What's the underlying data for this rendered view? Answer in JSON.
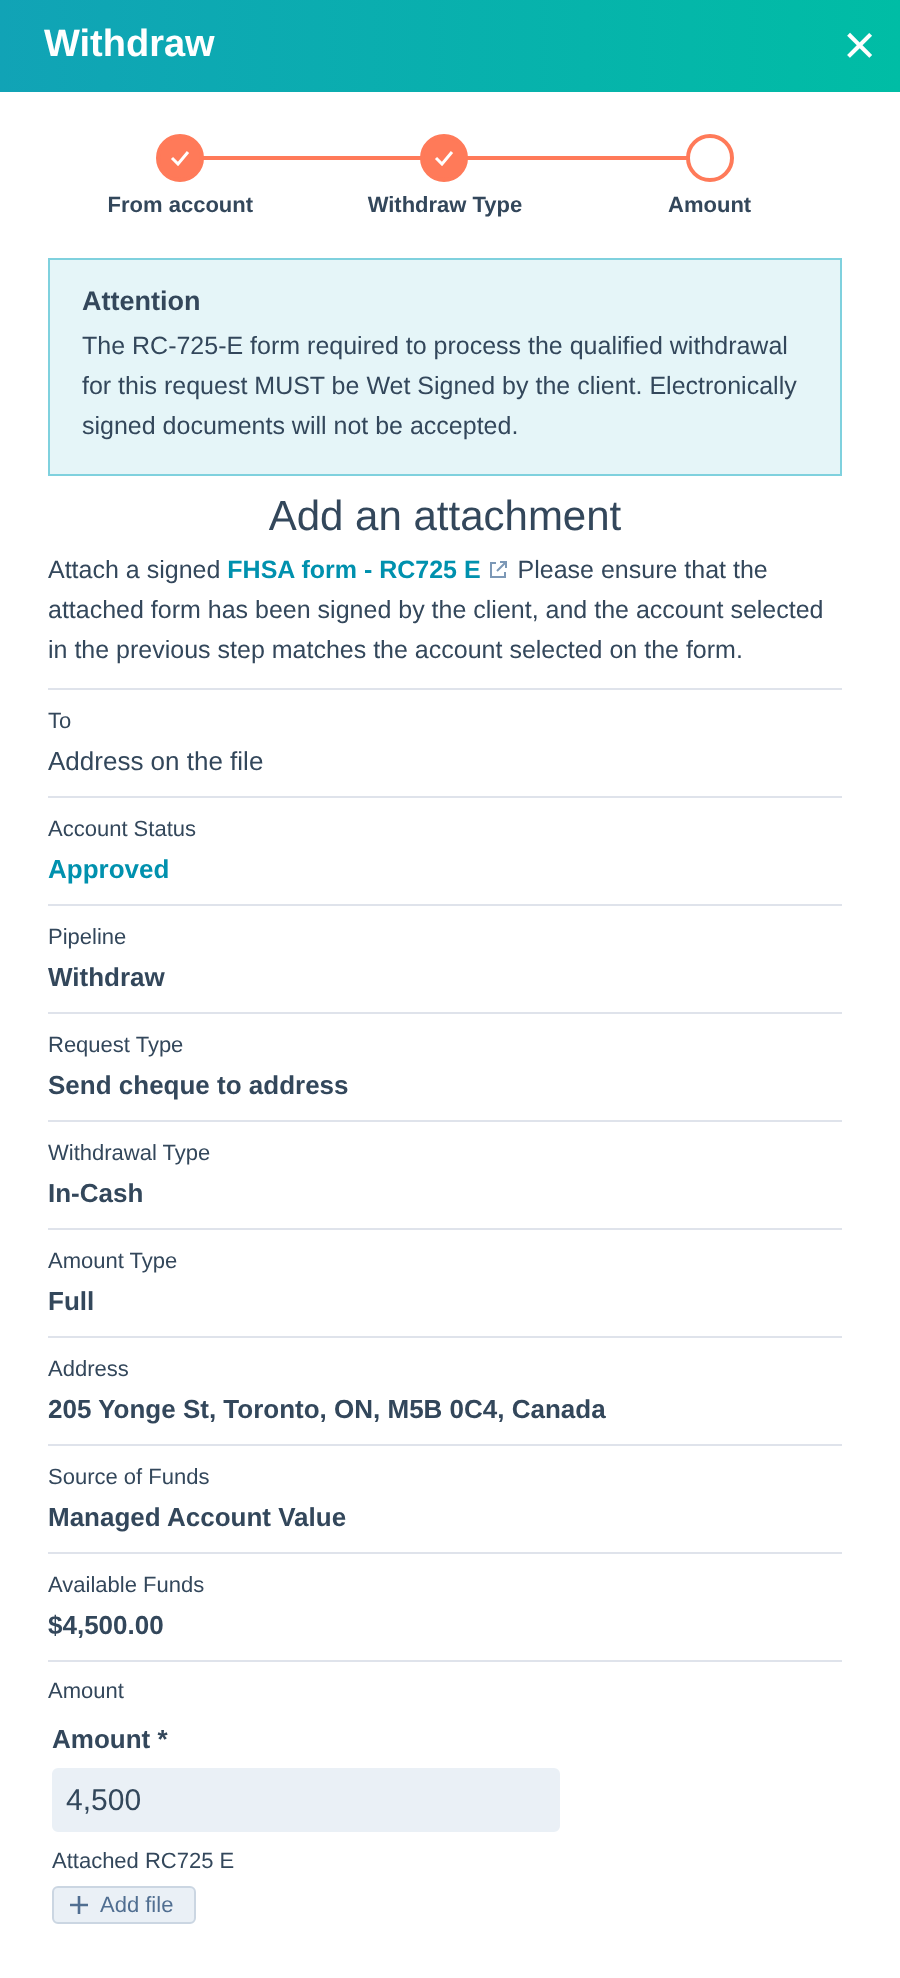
{
  "header": {
    "title": "Withdraw",
    "close": "×"
  },
  "steps": [
    {
      "label": "From account",
      "done": true
    },
    {
      "label": "Withdraw Type",
      "done": true
    },
    {
      "label": "Amount",
      "done": false
    }
  ],
  "alert": {
    "title": "Attention",
    "text": "The RC-725-E form required to process the qualified withdrawal for this request MUST be Wet Signed by the client. Electronically signed documents will not be accepted."
  },
  "attachment": {
    "heading": "Add an attachment",
    "before": "Attach a signed ",
    "link": "FHSA form - RC725 E",
    "after": " Please ensure that the attached form has been signed by the client, and the account selected in the previous step matches the account selected on the form."
  },
  "fields": [
    {
      "label": "To",
      "value": "Address on the file",
      "kind": "plain"
    },
    {
      "label": "Account Status",
      "value": "Approved",
      "kind": "status"
    },
    {
      "label": "Pipeline",
      "value": "Withdraw",
      "kind": "bold"
    },
    {
      "label": "Request Type",
      "value": "Send cheque to address",
      "kind": "bold"
    },
    {
      "label": "Withdrawal Type",
      "value": "In-Cash",
      "kind": "bold"
    },
    {
      "label": "Amount Type",
      "value": "Full",
      "kind": "bold"
    },
    {
      "label": "Address",
      "value": "205 Yonge St, Toronto, ON, M5B 0C4, Canada",
      "kind": "bold"
    },
    {
      "label": "Source of Funds",
      "value": "Managed Account Value",
      "kind": "bold"
    },
    {
      "label": "Available Funds",
      "value": "$4,500.00",
      "kind": "bold"
    }
  ],
  "amount": {
    "section": "Amount",
    "label": "Amount *",
    "value": "4,500",
    "attached_label": "Attached RC725 E",
    "add_file": "Add file"
  }
}
